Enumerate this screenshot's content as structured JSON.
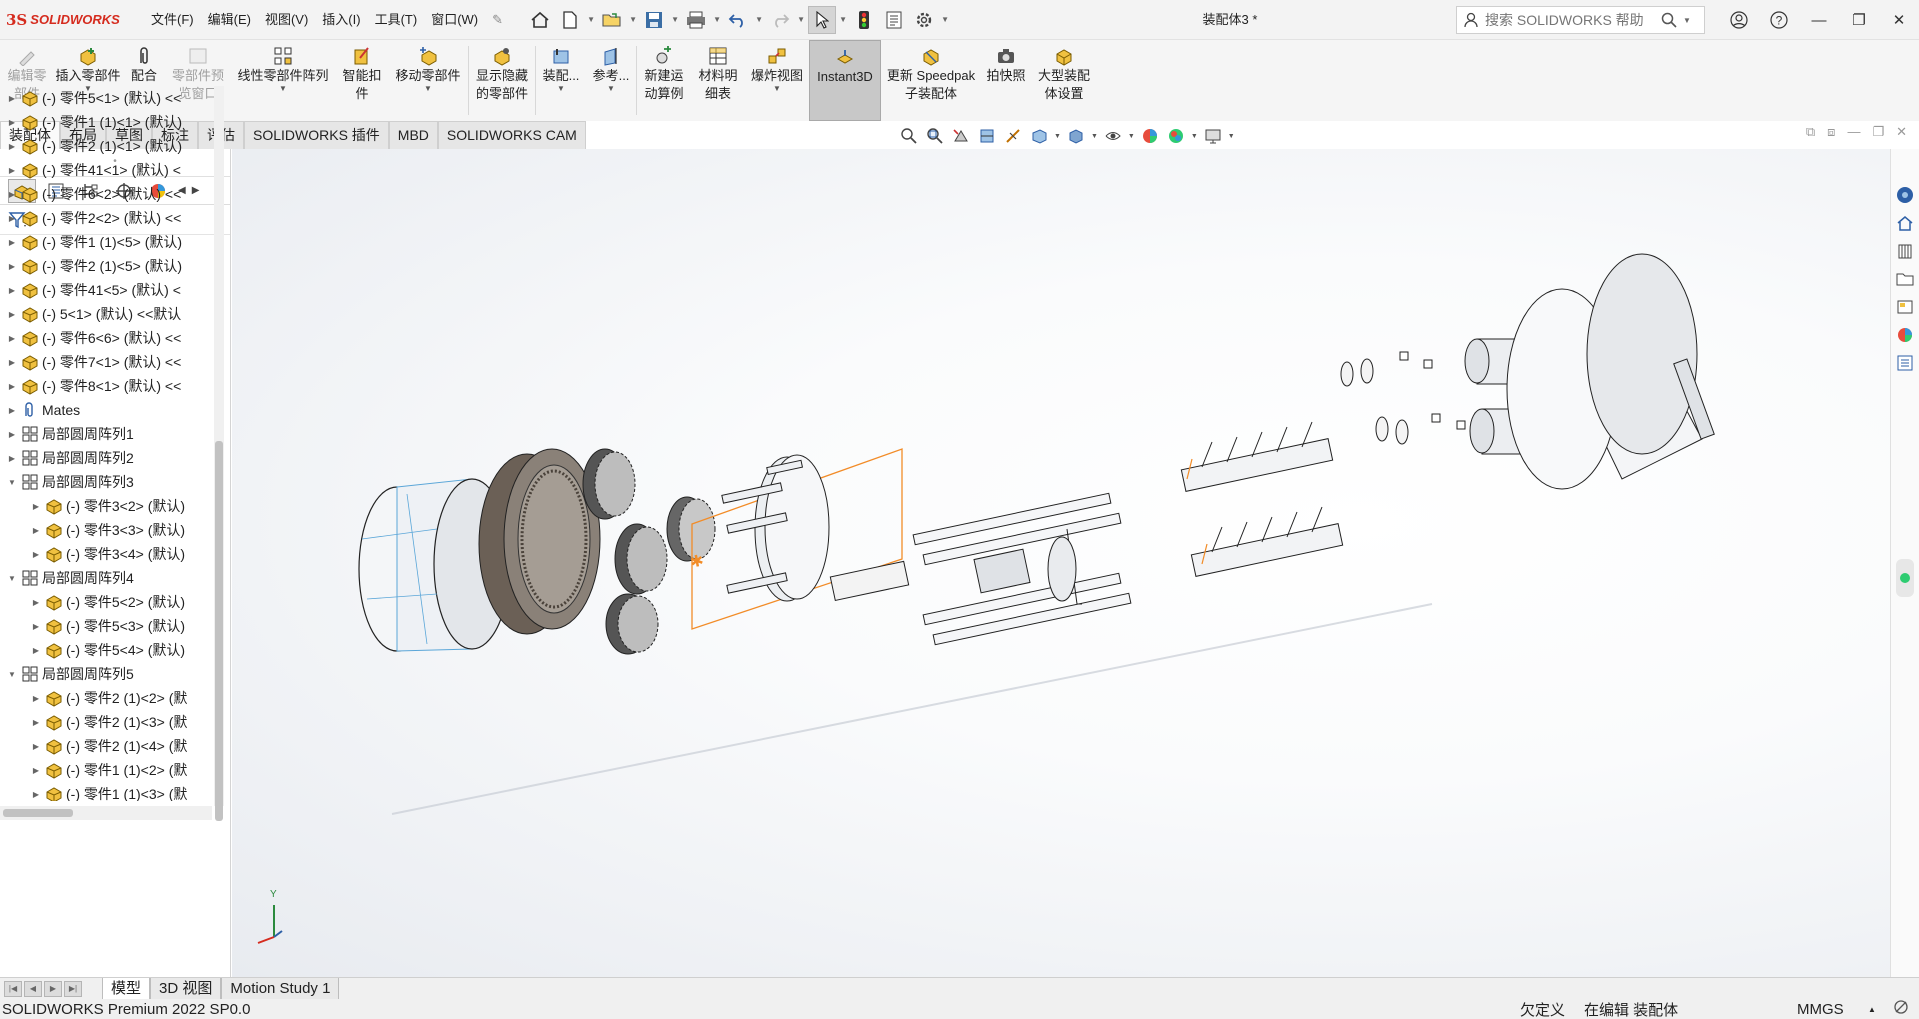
{
  "app": {
    "logo_ds": "3S",
    "logo_text": "SOLIDWORKS",
    "doc_title": "装配体3 *",
    "help_placeholder": "搜索 SOLIDWORKS 帮助"
  },
  "menu": [
    "文件(F)",
    "编辑(E)",
    "视图(V)",
    "插入(I)",
    "工具(T)",
    "窗口(W)"
  ],
  "ribbon": {
    "edit_part": "编辑零\n部件",
    "insert_part": "插入零部件",
    "mate": "配合",
    "part_preview": "零部件预\n览窗口",
    "linear_pattern": "线性零部件阵列",
    "smart_fastener": "智能扣\n件",
    "move_part": "移动零部件",
    "show_hidden": "显示隐藏\n的零部件",
    "assembly": "装配...",
    "reference": "参考...",
    "new_motion": "新建运\n动算例",
    "bom": "材料明\n细表",
    "exploded_view": "爆炸视图",
    "instant3d": "Instant3D",
    "speedpak": "更新 Speedpak\n子装配体",
    "snapshot": "拍快照",
    "large_assembly": "大型装配\n体设置"
  },
  "cmd_tabs": [
    "装配体",
    "布局",
    "草图",
    "标注",
    "评估",
    "SOLIDWORKS 插件",
    "MBD",
    "SOLIDWORKS CAM"
  ],
  "tree": [
    {
      "t": "(-) 零件5<1> (默认) <<",
      "lvl": 1,
      "icon": "part"
    },
    {
      "t": "(-) 零件1 (1)<1> (默认)",
      "lvl": 1,
      "icon": "part"
    },
    {
      "t": "(-) 零件2 (1)<1> (默认)",
      "lvl": 1,
      "icon": "part"
    },
    {
      "t": "(-) 零件41<1> (默认) <",
      "lvl": 1,
      "icon": "part"
    },
    {
      "t": "(-) 零件6<2> (默认) <<",
      "lvl": 1,
      "icon": "part"
    },
    {
      "t": "(-) 零件2<2> (默认) <<",
      "lvl": 1,
      "icon": "part"
    },
    {
      "t": "(-) 零件1 (1)<5> (默认)",
      "lvl": 1,
      "icon": "part"
    },
    {
      "t": "(-) 零件2 (1)<5> (默认)",
      "lvl": 1,
      "icon": "part"
    },
    {
      "t": "(-) 零件41<5> (默认) <",
      "lvl": 1,
      "icon": "part"
    },
    {
      "t": "(-) 5<1> (默认) <<默认",
      "lvl": 1,
      "icon": "part"
    },
    {
      "t": "(-) 零件6<6> (默认) <<",
      "lvl": 1,
      "icon": "part"
    },
    {
      "t": "(-) 零件7<1> (默认) <<",
      "lvl": 1,
      "icon": "part"
    },
    {
      "t": "(-) 零件8<1> (默认) <<",
      "lvl": 1,
      "icon": "part"
    },
    {
      "t": "Mates",
      "lvl": 1,
      "icon": "mates"
    },
    {
      "t": "局部圆周阵列1",
      "lvl": 1,
      "icon": "pattern"
    },
    {
      "t": "局部圆周阵列2",
      "lvl": 1,
      "icon": "pattern"
    },
    {
      "t": "局部圆周阵列3",
      "lvl": 1,
      "icon": "pattern",
      "open": true
    },
    {
      "t": "(-) 零件3<2> (默认)",
      "lvl": 2,
      "icon": "part"
    },
    {
      "t": "(-) 零件3<3> (默认)",
      "lvl": 2,
      "icon": "part"
    },
    {
      "t": "(-) 零件3<4> (默认)",
      "lvl": 2,
      "icon": "part"
    },
    {
      "t": "局部圆周阵列4",
      "lvl": 1,
      "icon": "pattern",
      "open": true
    },
    {
      "t": "(-) 零件5<2> (默认)",
      "lvl": 2,
      "icon": "part"
    },
    {
      "t": "(-) 零件5<3> (默认)",
      "lvl": 2,
      "icon": "part"
    },
    {
      "t": "(-) 零件5<4> (默认)",
      "lvl": 2,
      "icon": "part"
    },
    {
      "t": "局部圆周阵列5",
      "lvl": 1,
      "icon": "pattern",
      "open": true
    },
    {
      "t": "(-) 零件2 (1)<2> (默",
      "lvl": 2,
      "icon": "part"
    },
    {
      "t": "(-) 零件2 (1)<3> (默",
      "lvl": 2,
      "icon": "part"
    },
    {
      "t": "(-) 零件2 (1)<4> (默",
      "lvl": 2,
      "icon": "part"
    },
    {
      "t": "(-) 零件1 (1)<2> (默",
      "lvl": 2,
      "icon": "part"
    },
    {
      "t": "(-) 零件1 (1)<3> (默",
      "lvl": 2,
      "icon": "part"
    }
  ],
  "bottom_tabs": [
    "模型",
    "3D 视图",
    "Motion Study 1"
  ],
  "status": {
    "product": "SOLIDWORKS Premium 2022 SP0.0",
    "state": "欠定义",
    "mode": "在编辑 装配体",
    "units": "MMGS",
    "units_caret": "▲"
  },
  "triad": {
    "y": "Y"
  },
  "colors": {
    "accent_orange": "#f28c28",
    "brand_red": "#d52b1e",
    "ribbon_active": "#c8c8c8"
  }
}
